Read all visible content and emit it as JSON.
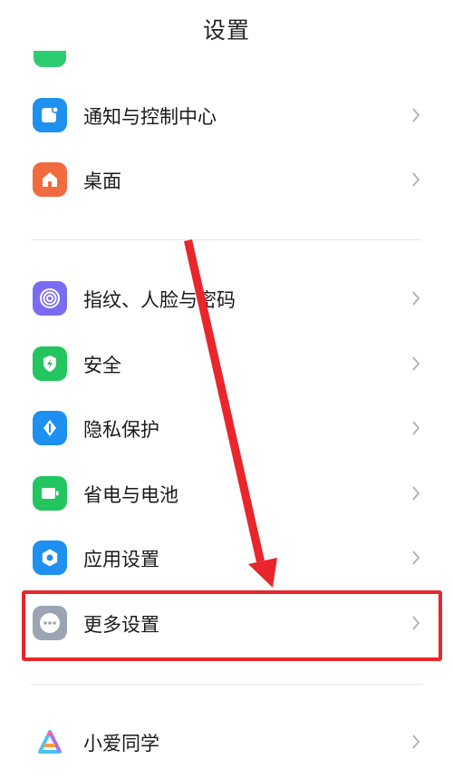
{
  "header": {
    "title": "设置"
  },
  "settings": {
    "items": [
      {
        "label": "通知与控制中心",
        "icon": "notification-icon",
        "color": "#1e90f0"
      },
      {
        "label": "桌面",
        "icon": "home-icon",
        "color": "#f26a3f"
      },
      {
        "label": "指纹、人脸与密码",
        "icon": "fingerprint-icon",
        "color": "#7a6cf2"
      },
      {
        "label": "安全",
        "icon": "shield-icon",
        "color": "#22c55e"
      },
      {
        "label": "隐私保护",
        "icon": "privacy-icon",
        "color": "#1e90f0"
      },
      {
        "label": "省电与电池",
        "icon": "battery-icon",
        "color": "#22c55e"
      },
      {
        "label": "应用设置",
        "icon": "gear-icon",
        "color": "#1e90f0"
      },
      {
        "label": "更多设置",
        "icon": "more-icon",
        "color": "#9aa4b2"
      },
      {
        "label": "小爱同学",
        "icon": "xiaoai-icon",
        "color": "#ffffff"
      }
    ]
  },
  "annotation": {
    "highlight_color": "#e8262b"
  }
}
